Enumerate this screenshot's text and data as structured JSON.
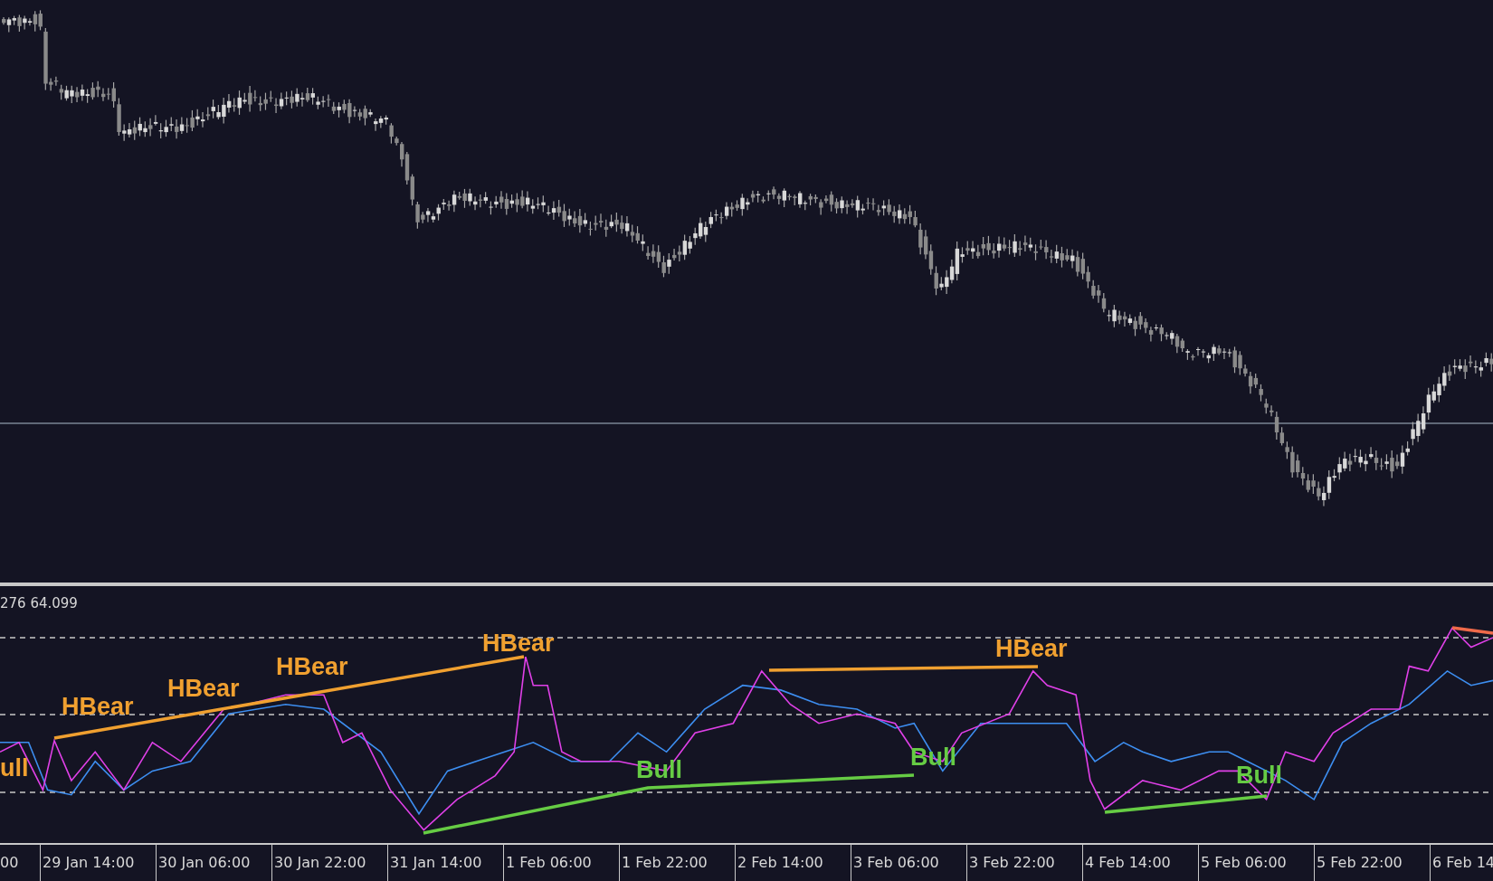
{
  "indicator": {
    "values": "276 64.099",
    "labels": [
      {
        "text": "ull",
        "color": "#f0a030"
      },
      {
        "text": "HBear",
        "color": "#f0a030"
      },
      {
        "text": "HBear",
        "color": "#f0a030"
      },
      {
        "text": "HBear",
        "color": "#f0a030"
      },
      {
        "text": "HBear",
        "color": "#f0a030"
      },
      {
        "text": "Bull",
        "color": "#66cc44"
      },
      {
        "text": "Bull",
        "color": "#66cc44"
      },
      {
        "text": "HBear",
        "color": "#f0a030"
      },
      {
        "text": "Bull",
        "color": "#66cc44"
      }
    ]
  },
  "time_axis": {
    "labels": [
      "00",
      "29 Jan 14:00",
      "30 Jan 06:00",
      "30 Jan 22:00",
      "31 Jan 14:00",
      "1 Feb 06:00",
      "1 Feb 22:00",
      "2 Feb 14:00",
      "3 Feb 06:00",
      "3 Feb 22:00",
      "4 Feb 14:00",
      "5 Feb 06:00",
      "5 Feb 22:00",
      "6 Feb 14"
    ]
  }
}
